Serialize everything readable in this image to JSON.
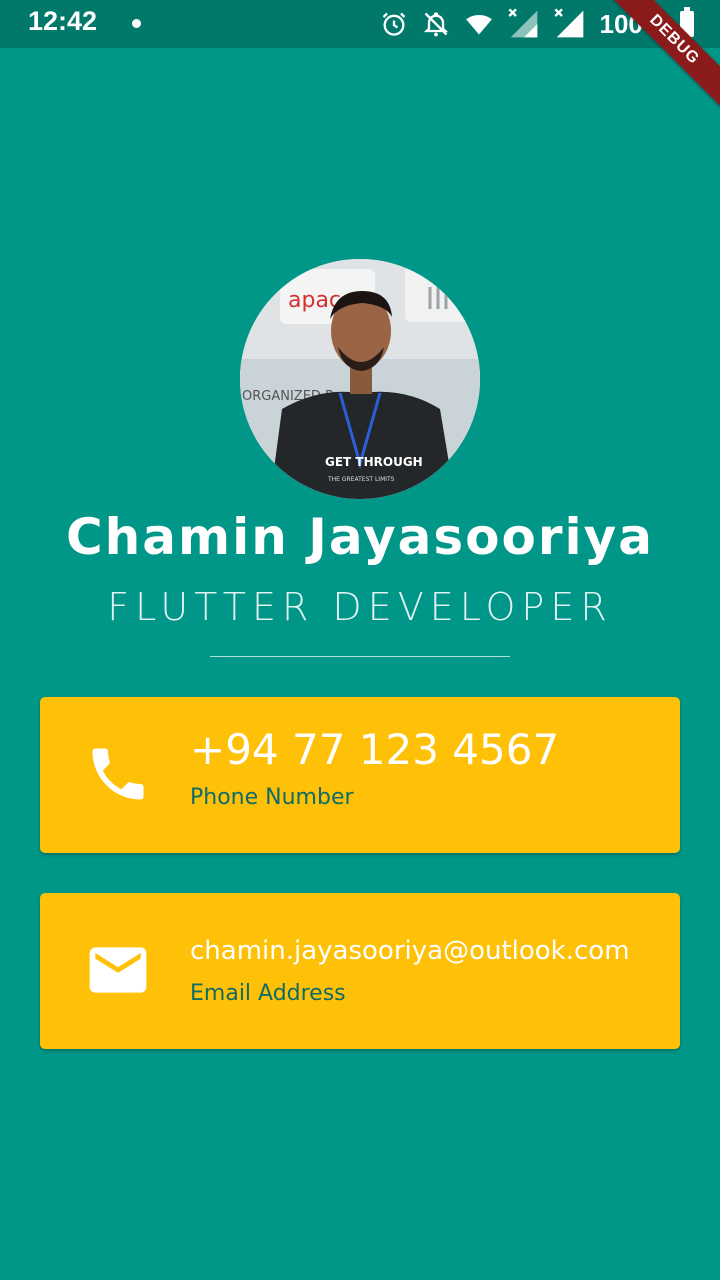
{
  "status_bar": {
    "time": "12:42",
    "battery": "100%",
    "icons": [
      "alarm-icon",
      "notifications-off-icon",
      "wifi-icon",
      "signal-icon",
      "signal-icon",
      "battery-icon"
    ]
  },
  "debug_banner": "DEBUG",
  "profile": {
    "name": "Chamin Jayasooriya",
    "title": "FLUTTER DEVELOPER",
    "photo_text": {
      "sign_left": "apac",
      "banner": "ORGANIZED B",
      "shirt": "GET THROUGH",
      "shirt_sub": "THE GREATEST LIMITS"
    }
  },
  "contacts": {
    "phone": {
      "value": "+94 77 123 4567",
      "label": "Phone Number",
      "icon": "phone-icon"
    },
    "email": {
      "value": "chamin.jayasooriya@outlook.com",
      "label": "Email Address",
      "icon": "mail-icon"
    }
  },
  "colors": {
    "background": "#009688",
    "status_bar": "#00796b",
    "card": "#ffc107",
    "label_text": "#0f6b63"
  }
}
